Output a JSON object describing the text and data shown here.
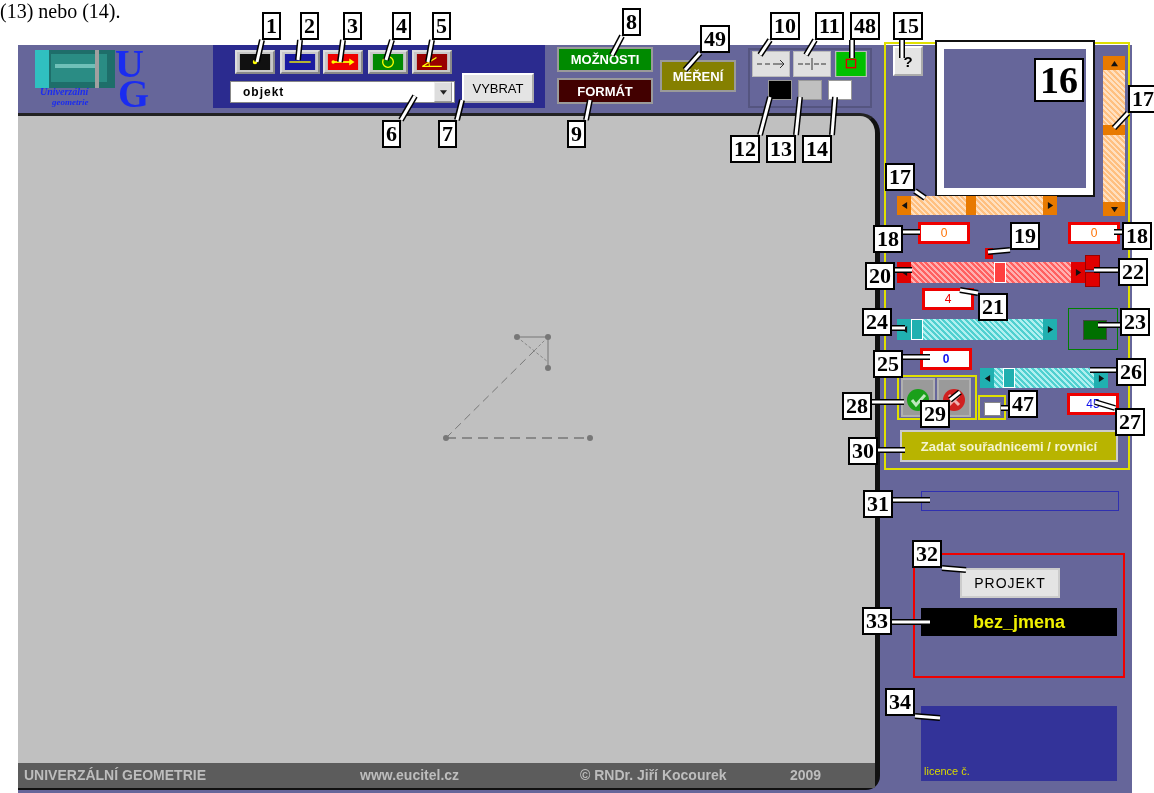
{
  "caption": "(13) nebo (14).",
  "logo": {
    "letter_1": "U",
    "letter_2": "G",
    "line_1": "Univerzální",
    "line_2": "geometrie"
  },
  "tools": [
    {
      "kind": "point"
    },
    {
      "kind": "line"
    },
    {
      "kind": "vector"
    },
    {
      "kind": "circle"
    },
    {
      "kind": "angle"
    }
  ],
  "object_select": {
    "value": "objekt"
  },
  "select_button": "VYBRAT",
  "options_button": "MOŽNOSTI",
  "format_button": "FORMÁT",
  "measure_button": "MĚŘENÍ",
  "line_styles": [
    {
      "kind": "dash-arrow"
    },
    {
      "kind": "dash-tick"
    },
    {
      "kind": "square"
    }
  ],
  "colors": [
    {
      "color": "#000000"
    },
    {
      "color": "#c0c0c0"
    },
    {
      "color": "#ffffff"
    }
  ],
  "help_button": "?",
  "preview": {
    "x_field": "0",
    "y_field": "0"
  },
  "thickness": {
    "level": 0.55,
    "value": "4"
  },
  "color_swatch": {
    "color": "#007000"
  },
  "slider_a": {
    "level": 0,
    "value": "0"
  },
  "slider_b": {
    "level": 0.1,
    "value": "45"
  },
  "checkbox": {
    "checked": false
  },
  "coords_button": "Zadat souřadnicemi / rovnicí",
  "project_button": "PROJEKT",
  "project_name": "bez_jmena",
  "license": "licence č.",
  "footer": [
    "UNIVERZÁLNÍ GEOMETRIE",
    "www.eucitel.cz",
    "© RNDr. Jiří Kocourek",
    "2009"
  ],
  "callouts": [
    "1",
    "2",
    "3",
    "4",
    "5",
    "6",
    "7",
    "8",
    "9",
    "49",
    "10",
    "11",
    "48",
    "15",
    "12",
    "13",
    "14",
    "16",
    "17",
    "17",
    "18",
    "19",
    "18",
    "20",
    "22",
    "21",
    "23",
    "24",
    "25",
    "26",
    "28",
    "29",
    "47",
    "27",
    "30",
    "31",
    "32",
    "33",
    "34"
  ]
}
